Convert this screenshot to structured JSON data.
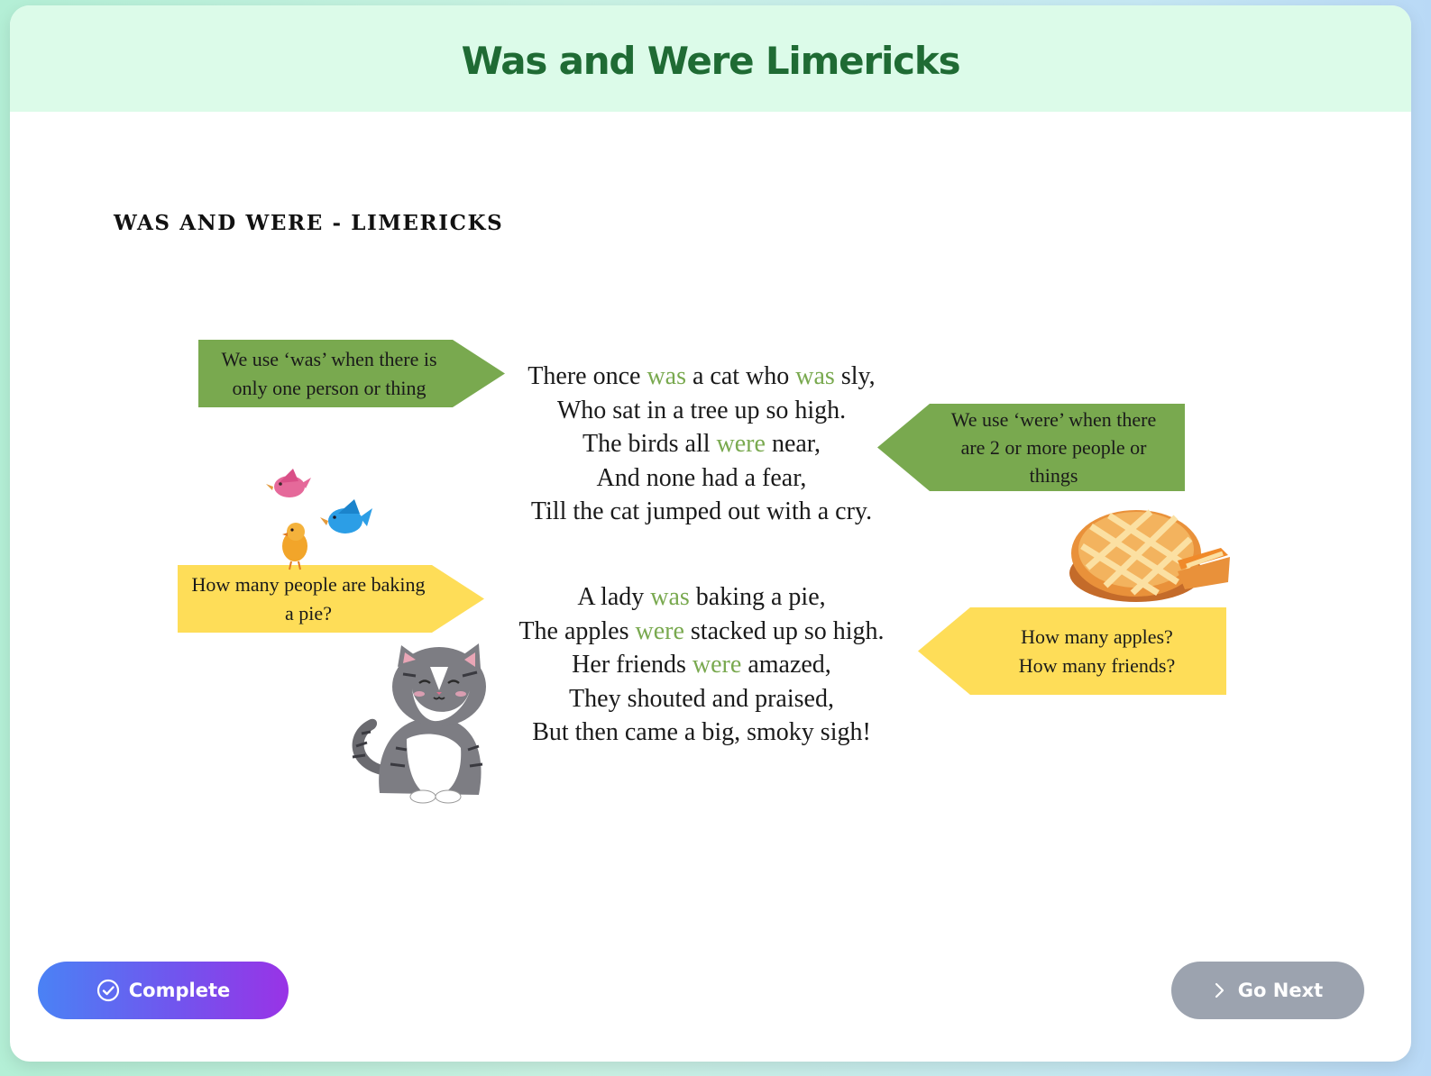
{
  "header": {
    "title": "Was and Were Limericks"
  },
  "worksheet": {
    "heading": "WAS AND WERE - LIMERICKS",
    "tags": {
      "was_rule": "We use ‘was’ when there is\nonly one person or thing",
      "were_rule": "We use ‘were’ when there\nare 2 or more people or\nthings",
      "baking_question": "How many people are baking\na pie?",
      "apples_question": "How many apples?\nHow many friends?"
    },
    "poem1": {
      "line1": {
        "a": "There once ",
        "b": "was",
        "c": " a cat who ",
        "d": "was",
        "e": " sly,"
      },
      "line2": "Who sat in a tree up so high.",
      "line3": {
        "a": "The birds all ",
        "b": "were",
        "c": " near,"
      },
      "line4": "And none had a fear,",
      "line5": "Till the cat jumped out with a cry."
    },
    "poem2": {
      "line1": {
        "a": "A lady ",
        "b": "was",
        "c": " baking a pie,"
      },
      "line2": {
        "a": "The apples ",
        "b": "were",
        "c": " stacked up so high."
      },
      "line3": {
        "a": "Her friends ",
        "b": "were",
        "c": " amazed,"
      },
      "line4": "They shouted and praised,",
      "line5": "But then came a big, smoky sigh!"
    }
  },
  "footer": {
    "complete_label": "Complete",
    "next_label": "Go Next"
  },
  "colors": {
    "highlight": "#79a94f",
    "green_tag": "#79a94f",
    "yellow_tag": "#fedd58",
    "title": "#1f6b34"
  },
  "icons": {
    "complete": "check-circle-icon",
    "next": "chevron-right-icon"
  }
}
